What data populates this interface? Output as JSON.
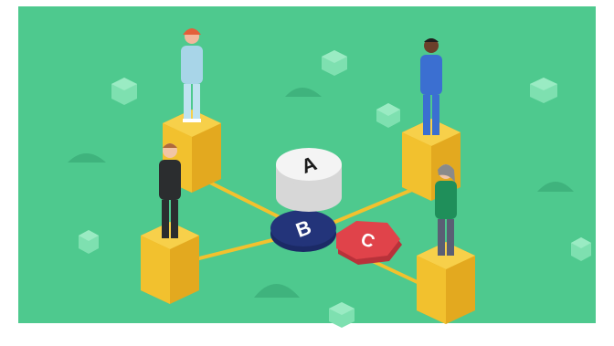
{
  "scene": {
    "background_color": "#4ec98e",
    "accent_yellow": "#f2c12e",
    "accent_navy": "#23347a",
    "accent_red": "#e0434a",
    "disc_labels": {
      "a": "A",
      "b": "B",
      "c": "C"
    },
    "people": [
      {
        "name": "person-left-top",
        "outfit": "light-blue-scrubs"
      },
      {
        "name": "person-left-bottom",
        "outfit": "dark-jumpsuit"
      },
      {
        "name": "person-right-top",
        "outfit": "blue-scrubs"
      },
      {
        "name": "person-right-bottom",
        "outfit": "green-shirt"
      }
    ]
  }
}
